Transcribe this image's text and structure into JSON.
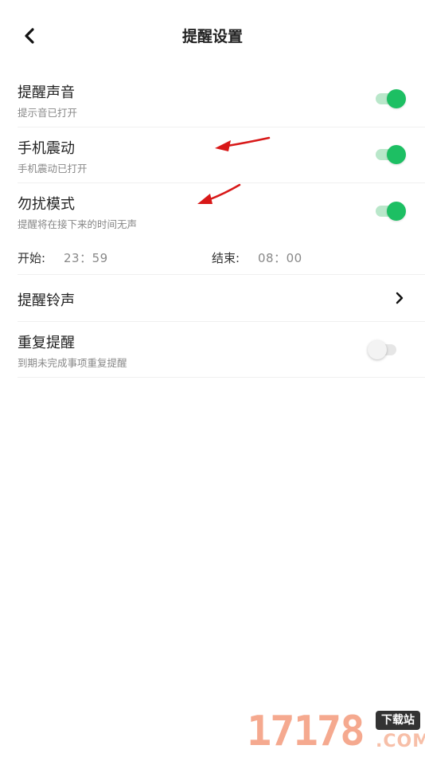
{
  "header": {
    "title": "提醒设置",
    "back_icon": "chevron-left-icon"
  },
  "settings": {
    "reminder_sound": {
      "title": "提醒声音",
      "subtitle": "提示音已打开",
      "enabled": true
    },
    "vibration": {
      "title": "手机震动",
      "subtitle": "手机震动已打开",
      "enabled": true
    },
    "dnd": {
      "title": "勿扰模式",
      "subtitle": "提醒将在接下来的时间无声",
      "enabled": true,
      "start_label": "开始:",
      "start_time": "23：59",
      "end_label": "结束:",
      "end_time": "08：00"
    },
    "ringtone": {
      "title": "提醒铃声",
      "chevron_icon": "chevron-right-icon"
    },
    "repeat": {
      "title": "重复提醒",
      "subtitle": "到期未完成事项重复提醒",
      "enabled": false
    }
  },
  "watermark": {
    "number": "17178",
    "badge": "下载站",
    "suffix": ".COM"
  },
  "colors": {
    "toggle_on": "#1dbf63",
    "toggle_on_track": "#b9e7ca",
    "toggle_off_track": "#e6e6e6",
    "annotation_arrow": "#d81818"
  }
}
